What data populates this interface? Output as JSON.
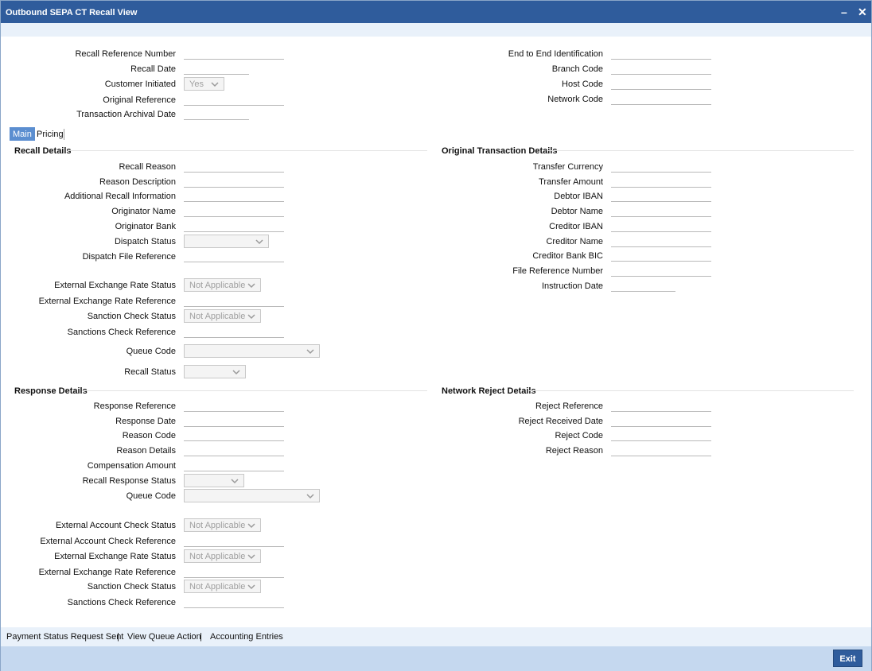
{
  "window": {
    "title": "Outbound SEPA CT Recall View",
    "minimize_glyph": "–",
    "close_glyph": "✕"
  },
  "header_left": {
    "recall_reference_number": "Recall Reference Number",
    "recall_date": "Recall Date",
    "customer_initiated": "Customer Initiated",
    "customer_initiated_value": "Yes",
    "original_reference": "Original Reference",
    "transaction_archival_date": "Transaction Archival Date"
  },
  "header_right": {
    "end_to_end_identification": "End to End Identification",
    "branch_code": "Branch Code",
    "host_code": "Host Code",
    "network_code": "Network Code"
  },
  "tabs": {
    "main": "Main",
    "pricing": "Pricing"
  },
  "recall_details": {
    "title": "Recall Details",
    "recall_reason": "Recall Reason",
    "reason_description": "Reason Description",
    "additional_recall_information": "Additional Recall Information",
    "originator_name": "Originator Name",
    "originator_bank": "Originator Bank",
    "dispatch_status": "Dispatch Status",
    "dispatch_file_reference": "Dispatch File Reference",
    "external_exchange_rate_status": "External Exchange Rate Status",
    "external_exchange_rate_status_value": "Not Applicable",
    "external_exchange_rate_reference": "External Exchange Rate Reference",
    "sanction_check_status": "Sanction Check Status",
    "sanction_check_status_value": "Not Applicable",
    "sanctions_check_reference": "Sanctions Check Reference",
    "queue_code": "Queue Code",
    "recall_status": "Recall Status"
  },
  "original_transaction_details": {
    "title": "Original Transaction Details",
    "transfer_currency": "Transfer Currency",
    "transfer_amount": "Transfer Amount",
    "debtor_iban": "Debtor IBAN",
    "debtor_name": "Debtor Name",
    "creditor_iban": "Creditor IBAN",
    "creditor_name": "Creditor Name",
    "creditor_bank_bic": "Creditor Bank BIC",
    "file_reference_number": "File Reference Number",
    "instruction_date": "Instruction Date"
  },
  "response_details": {
    "title": "Response Details",
    "response_reference": "Response Reference",
    "response_date": "Response Date",
    "reason_code": "Reason Code",
    "reason_details": "Reason Details",
    "compensation_amount": "Compensation Amount",
    "recall_response_status": "Recall Response Status",
    "queue_code": "Queue Code",
    "external_account_check_status": "External Account Check Status",
    "external_account_check_status_value": "Not Applicable",
    "external_account_check_reference": "External Account Check Reference",
    "external_exchange_rate_status": "External Exchange Rate Status",
    "external_exchange_rate_status_value": "Not Applicable",
    "external_exchange_rate_reference": "External Exchange Rate Reference",
    "sanction_check_status": "Sanction Check Status",
    "sanction_check_status_value": "Not Applicable",
    "sanctions_check_reference": "Sanctions Check Reference"
  },
  "network_reject_details": {
    "title": "Network Reject Details",
    "reject_reference": "Reject Reference",
    "reject_received_date": "Reject Received Date",
    "reject_code": "Reject Code",
    "reject_reason": "Reject Reason"
  },
  "footer": {
    "payment_status_request_sent": "Payment Status Request Sent",
    "view_queue_action": "View Queue Action",
    "accounting_entries": "Accounting Entries",
    "separator": "|",
    "exit": "Exit"
  },
  "colors": {
    "titlebar": "#2f5c9c",
    "tab_active": "#5b8ed0",
    "bottombar": "#c5d8ef",
    "footer": "#e9f1fa"
  },
  "icons": {
    "dropdown": "chevron-down-icon",
    "minimize": "minimize-icon",
    "close": "close-icon"
  }
}
